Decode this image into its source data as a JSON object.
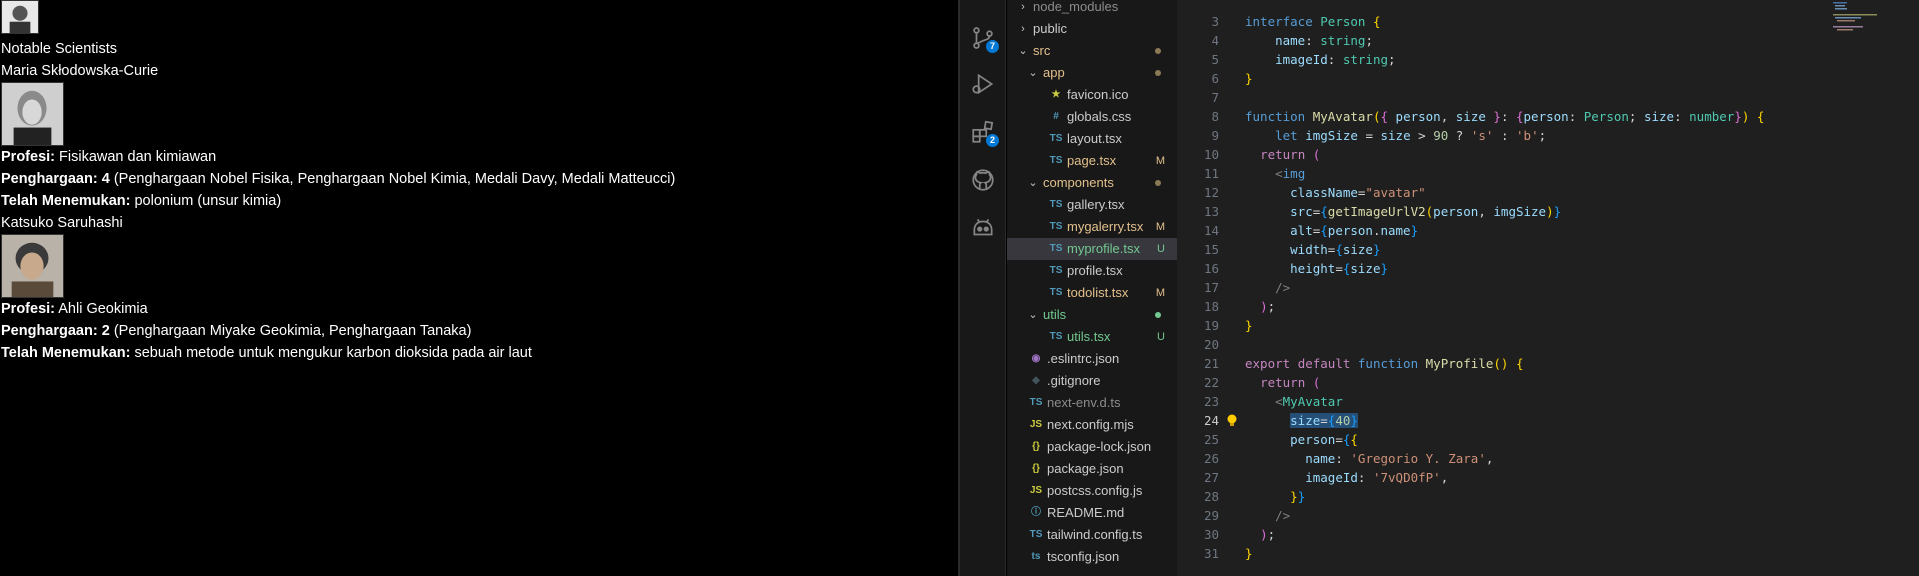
{
  "preview": {
    "heading": "Notable Scientists",
    "scientists": [
      {
        "name": "Maria Skłodowska-Curie",
        "profession_label": "Profesi:",
        "profession": "Fisikawan dan kimiawan",
        "awards_label": "Penghargaan: 4",
        "awards": "(Penghargaan Nobel Fisika, Penghargaan Nobel Kimia, Medali Davy, Medali Matteucci)",
        "discovery_label": "Telah Menemukan:",
        "discovery": "polonium (unsur kimia)"
      },
      {
        "name": "Katsuko Saruhashi",
        "profession_label": "Profesi:",
        "profession": "Ahli Geokimia",
        "awards_label": "Penghargaan: 2",
        "awards": "(Penghargaan Miyake Geokimia, Penghargaan Tanaka)",
        "discovery_label": "Telah Menemukan:",
        "discovery": "sebuah metode untuk mengukur karbon dioksida pada air laut"
      }
    ]
  },
  "activity_bar": {
    "scm_badge": "7",
    "extensions_badge": "2"
  },
  "explorer": {
    "items": [
      {
        "label": "node_modules",
        "kind": "folder",
        "open": false,
        "indent": 0,
        "color": "#8c8c8c",
        "status": ""
      },
      {
        "label": "public",
        "kind": "folder",
        "open": false,
        "indent": 0,
        "color": "#cccccc",
        "status": ""
      },
      {
        "label": "src",
        "kind": "folder",
        "open": true,
        "indent": 0,
        "color": "#e2c08d",
        "status": "dot"
      },
      {
        "label": "app",
        "kind": "folder",
        "open": true,
        "indent": 1,
        "color": "#e2c08d",
        "status": "dot"
      },
      {
        "label": "favicon.ico",
        "kind": "ico",
        "indent": 2,
        "color": "#cccccc",
        "status": ""
      },
      {
        "label": "globals.css",
        "kind": "css",
        "indent": 2,
        "color": "#cccccc",
        "status": ""
      },
      {
        "label": "layout.tsx",
        "kind": "ts",
        "indent": 2,
        "color": "#cccccc",
        "status": ""
      },
      {
        "label": "page.tsx",
        "kind": "ts",
        "indent": 2,
        "color": "#e2c08d",
        "status": "M"
      },
      {
        "label": "components",
        "kind": "folder",
        "open": true,
        "indent": 1,
        "color": "#e2c08d",
        "status": "dot"
      },
      {
        "label": "gallery.tsx",
        "kind": "ts",
        "indent": 2,
        "color": "#cccccc",
        "status": ""
      },
      {
        "label": "mygalerry.tsx",
        "kind": "ts",
        "indent": 2,
        "color": "#e2c08d",
        "status": "M"
      },
      {
        "label": "myprofile.tsx",
        "kind": "ts",
        "indent": 2,
        "color": "#73c991",
        "status": "U",
        "selected": true
      },
      {
        "label": "profile.tsx",
        "kind": "ts",
        "indent": 2,
        "color": "#cccccc",
        "status": ""
      },
      {
        "label": "todolist.tsx",
        "kind": "ts",
        "indent": 2,
        "color": "#e2c08d",
        "status": "M"
      },
      {
        "label": "utils",
        "kind": "folder",
        "open": true,
        "indent": 1,
        "color": "#73c991",
        "status": "dotg"
      },
      {
        "label": "utils.tsx",
        "kind": "ts",
        "indent": 2,
        "color": "#73c991",
        "status": "U"
      },
      {
        "label": ".eslintrc.json",
        "kind": "eslint",
        "indent": 0,
        "color": "#cccccc",
        "status": ""
      },
      {
        "label": ".gitignore",
        "kind": "git",
        "indent": 0,
        "color": "#cccccc",
        "status": ""
      },
      {
        "label": "next-env.d.ts",
        "kind": "ts",
        "indent": 0,
        "color": "#8c8c8c",
        "status": ""
      },
      {
        "label": "next.config.mjs",
        "kind": "js",
        "indent": 0,
        "color": "#cccccc",
        "status": ""
      },
      {
        "label": "package-lock.json",
        "kind": "json",
        "indent": 0,
        "color": "#cccccc",
        "status": ""
      },
      {
        "label": "package.json",
        "kind": "json",
        "indent": 0,
        "color": "#cccccc",
        "status": ""
      },
      {
        "label": "postcss.config.js",
        "kind": "js",
        "indent": 0,
        "color": "#cccccc",
        "status": ""
      },
      {
        "label": "README.md",
        "kind": "info",
        "indent": 0,
        "color": "#cccccc",
        "status": ""
      },
      {
        "label": "tailwind.config.ts",
        "kind": "ts",
        "indent": 0,
        "color": "#cccccc",
        "status": ""
      },
      {
        "label": "tsconfig.json",
        "kind": "tsjson",
        "indent": 0,
        "color": "#cccccc",
        "status": ""
      }
    ]
  },
  "editor": {
    "active_line": 24,
    "lines": [
      {
        "no": 3,
        "tokens": [
          [
            "k",
            "interface "
          ],
          [
            "t",
            "Person "
          ],
          [
            "y",
            "{"
          ]
        ]
      },
      {
        "no": 4,
        "tokens": [
          [
            "w",
            "    "
          ],
          [
            "p",
            "name"
          ],
          [
            "w",
            ": "
          ],
          [
            "t",
            "string"
          ],
          [
            "w",
            ";"
          ]
        ]
      },
      {
        "no": 5,
        "tokens": [
          [
            "w",
            "    "
          ],
          [
            "p",
            "imageId"
          ],
          [
            "w",
            ": "
          ],
          [
            "t",
            "string"
          ],
          [
            "w",
            ";"
          ]
        ]
      },
      {
        "no": 6,
        "tokens": [
          [
            "y",
            "}"
          ]
        ]
      },
      {
        "no": 7,
        "tokens": []
      },
      {
        "no": 8,
        "tokens": [
          [
            "k",
            "function "
          ],
          [
            "f",
            "MyAvatar"
          ],
          [
            "y",
            "("
          ],
          [
            "m",
            "{ "
          ],
          [
            "p",
            "person"
          ],
          [
            "w",
            ", "
          ],
          [
            "p",
            "size "
          ],
          [
            "m",
            "}"
          ],
          [
            "w",
            ": "
          ],
          [
            "m",
            "{"
          ],
          [
            "p",
            "person"
          ],
          [
            "w",
            ": "
          ],
          [
            "t",
            "Person"
          ],
          [
            "w",
            "; "
          ],
          [
            "p",
            "size"
          ],
          [
            "w",
            ": "
          ],
          [
            "t",
            "number"
          ],
          [
            "m",
            "}"
          ],
          [
            "y",
            ")"
          ],
          [
            "w",
            " "
          ],
          [
            "y",
            "{"
          ]
        ]
      },
      {
        "no": 9,
        "tokens": [
          [
            "w",
            "    "
          ],
          [
            "k",
            "let "
          ],
          [
            "p",
            "imgSize "
          ],
          [
            "w",
            "= "
          ],
          [
            "p",
            "size "
          ],
          [
            "w",
            "> "
          ],
          [
            "n",
            "90 "
          ],
          [
            "w",
            "? "
          ],
          [
            "s",
            "'s' "
          ],
          [
            "w",
            ": "
          ],
          [
            "s",
            "'b'"
          ],
          [
            "w",
            ";"
          ]
        ]
      },
      {
        "no": 10,
        "tokens": [
          [
            "w",
            "  "
          ],
          [
            "c",
            "return "
          ],
          [
            "m",
            "("
          ]
        ]
      },
      {
        "no": 11,
        "tokens": [
          [
            "w",
            "    "
          ],
          [
            "g",
            "<"
          ],
          [
            "k",
            "img"
          ]
        ]
      },
      {
        "no": 12,
        "tokens": [
          [
            "w",
            "      "
          ],
          [
            "p",
            "className"
          ],
          [
            "w",
            "="
          ],
          [
            "s",
            "\"avatar\""
          ]
        ]
      },
      {
        "no": 13,
        "tokens": [
          [
            "w",
            "      "
          ],
          [
            "p",
            "src"
          ],
          [
            "w",
            "="
          ],
          [
            "b",
            "{"
          ],
          [
            "f",
            "getImageUrlV2"
          ],
          [
            "y",
            "("
          ],
          [
            "p",
            "person"
          ],
          [
            "w",
            ", "
          ],
          [
            "p",
            "imgSize"
          ],
          [
            "y",
            ")"
          ],
          [
            "b",
            "}"
          ]
        ]
      },
      {
        "no": 14,
        "tokens": [
          [
            "w",
            "      "
          ],
          [
            "p",
            "alt"
          ],
          [
            "w",
            "="
          ],
          [
            "b",
            "{"
          ],
          [
            "p",
            "person"
          ],
          [
            "w",
            "."
          ],
          [
            "p",
            "name"
          ],
          [
            "b",
            "}"
          ]
        ]
      },
      {
        "no": 15,
        "tokens": [
          [
            "w",
            "      "
          ],
          [
            "p",
            "width"
          ],
          [
            "w",
            "="
          ],
          [
            "b",
            "{"
          ],
          [
            "p",
            "size"
          ],
          [
            "b",
            "}"
          ]
        ]
      },
      {
        "no": 16,
        "tokens": [
          [
            "w",
            "      "
          ],
          [
            "p",
            "height"
          ],
          [
            "w",
            "="
          ],
          [
            "b",
            "{"
          ],
          [
            "p",
            "size"
          ],
          [
            "b",
            "}"
          ]
        ]
      },
      {
        "no": 17,
        "tokens": [
          [
            "w",
            "    "
          ],
          [
            "g",
            "/>"
          ]
        ]
      },
      {
        "no": 18,
        "tokens": [
          [
            "w",
            "  "
          ],
          [
            "m",
            ")"
          ],
          [
            "w",
            ";"
          ]
        ]
      },
      {
        "no": 19,
        "tokens": [
          [
            "y",
            "}"
          ]
        ]
      },
      {
        "no": 20,
        "tokens": []
      },
      {
        "no": 21,
        "tokens": [
          [
            "c",
            "export "
          ],
          [
            "c",
            "default "
          ],
          [
            "k",
            "function "
          ],
          [
            "f",
            "MyProfile"
          ],
          [
            "y",
            "()"
          ],
          [
            "w",
            " "
          ],
          [
            "y",
            "{"
          ]
        ]
      },
      {
        "no": 22,
        "tokens": [
          [
            "w",
            "  "
          ],
          [
            "c",
            "return "
          ],
          [
            "m",
            "("
          ]
        ]
      },
      {
        "no": 23,
        "tokens": [
          [
            "w",
            "    "
          ],
          [
            "g",
            "<"
          ],
          [
            "t",
            "MyAvatar"
          ]
        ]
      },
      {
        "no": 24,
        "tokens": [
          [
            "w",
            "      "
          ],
          [
            "sel",
            "size={40}"
          ]
        ]
      },
      {
        "no": 25,
        "tokens": [
          [
            "w",
            "      "
          ],
          [
            "p",
            "person"
          ],
          [
            "w",
            "="
          ],
          [
            "b",
            "{"
          ],
          [
            "y",
            "{"
          ]
        ]
      },
      {
        "no": 26,
        "tokens": [
          [
            "w",
            "        "
          ],
          [
            "p",
            "name"
          ],
          [
            "w",
            ": "
          ],
          [
            "s",
            "'Gregorio Y. Zara'"
          ],
          [
            "w",
            ","
          ]
        ]
      },
      {
        "no": 27,
        "tokens": [
          [
            "w",
            "        "
          ],
          [
            "p",
            "imageId"
          ],
          [
            "w",
            ": "
          ],
          [
            "s",
            "'7vQD0fP'"
          ],
          [
            "w",
            ","
          ]
        ]
      },
      {
        "no": 28,
        "tokens": [
          [
            "w",
            "      "
          ],
          [
            "y",
            "}"
          ],
          [
            "b",
            "}"
          ]
        ]
      },
      {
        "no": 29,
        "tokens": [
          [
            "w",
            "    "
          ],
          [
            "g",
            "/>"
          ]
        ]
      },
      {
        "no": 30,
        "tokens": [
          [
            "w",
            "  "
          ],
          [
            "m",
            ")"
          ],
          [
            "w",
            ";"
          ]
        ]
      },
      {
        "no": 31,
        "tokens": [
          [
            "y",
            "}"
          ]
        ]
      }
    ]
  }
}
